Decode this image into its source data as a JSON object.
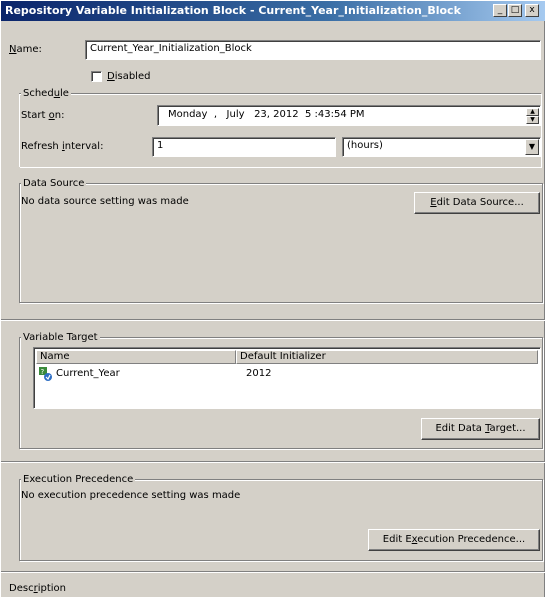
{
  "window": {
    "title": "Repository Variable Initialization Block - Current_Year_Initialization_Block",
    "minimize_glyph": "_",
    "maximize_glyph": "□",
    "close_glyph": "x"
  },
  "name_field": {
    "label_pre": "",
    "label_accel": "N",
    "label_post": "ame:",
    "value": "Current_Year_Initialization_Block"
  },
  "disabled": {
    "label_accel": "D",
    "label_post": "isabled",
    "checked": false
  },
  "schedule": {
    "group_pre": "Sched",
    "group_accel": "u",
    "group_post": "le",
    "start_label_pre": "Start ",
    "start_label_accel": "o",
    "start_label_post": "n:",
    "start_value": "Monday  ,   July   23, 2012  5 :43:54 PM",
    "refresh_label_pre": "Refresh ",
    "refresh_label_accel": "i",
    "refresh_label_post": "nterval:",
    "refresh_value": "1",
    "unit_value": "(hours)"
  },
  "data_source": {
    "group_title": "Data Source",
    "message": "No data source setting was made",
    "edit_button_accel": "E",
    "edit_button_post": "dit Data Source..."
  },
  "variable_target": {
    "group_title": "Variable Target",
    "columns": [
      "Name",
      "Default Initializer"
    ],
    "rows": [
      {
        "name": "Current_Year",
        "initializer": "2012",
        "icon": "variable-icon"
      }
    ],
    "edit_button_pre": "Edit Data ",
    "edit_button_accel": "T",
    "edit_button_post": "arget..."
  },
  "execution_precedence": {
    "group_title": "Execution Precedence",
    "message": "No execution precedence setting was made",
    "edit_button_pre": "Edit E",
    "edit_button_accel": "x",
    "edit_button_post": "ecution Precedence..."
  },
  "description": {
    "label_pre": "Desc",
    "label_accel": "r",
    "label_post": "iption"
  },
  "icons": {
    "combo_arrow": "▼",
    "spin_up": "▲",
    "spin_down": "▼"
  }
}
